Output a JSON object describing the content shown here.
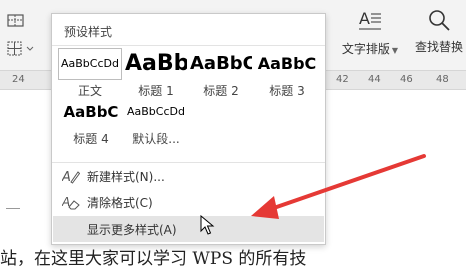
{
  "ribbon": {
    "text_layout_label": "文字排版",
    "find_replace_label": "查找替换"
  },
  "ruler": {
    "numbers": [
      "24",
      "42",
      "44",
      "46",
      "48"
    ]
  },
  "document": {
    "text": "站，在这里大家可以学习 WPS 的所有技"
  },
  "style_panel": {
    "header": "预设样式",
    "styles": [
      {
        "preview": "AaBbCcDd",
        "caption": "正文"
      },
      {
        "preview": "AaBb",
        "caption": "标题 1"
      },
      {
        "preview": "AaBbC",
        "caption": "标题 2"
      },
      {
        "preview": "AaBbC",
        "caption": "标题 3"
      },
      {
        "preview": "AaBbC",
        "caption": "标题 4"
      },
      {
        "preview": "AaBbCcDd",
        "caption": "默认段..."
      }
    ],
    "menu": [
      {
        "label": "新建样式(N)...",
        "icon": "new-style-icon"
      },
      {
        "label": "清除格式(C)",
        "icon": "eraser-icon"
      },
      {
        "label": "显示更多样式(A)",
        "icon": ""
      }
    ]
  },
  "colors": {
    "annotation_arrow": "#e53935"
  }
}
